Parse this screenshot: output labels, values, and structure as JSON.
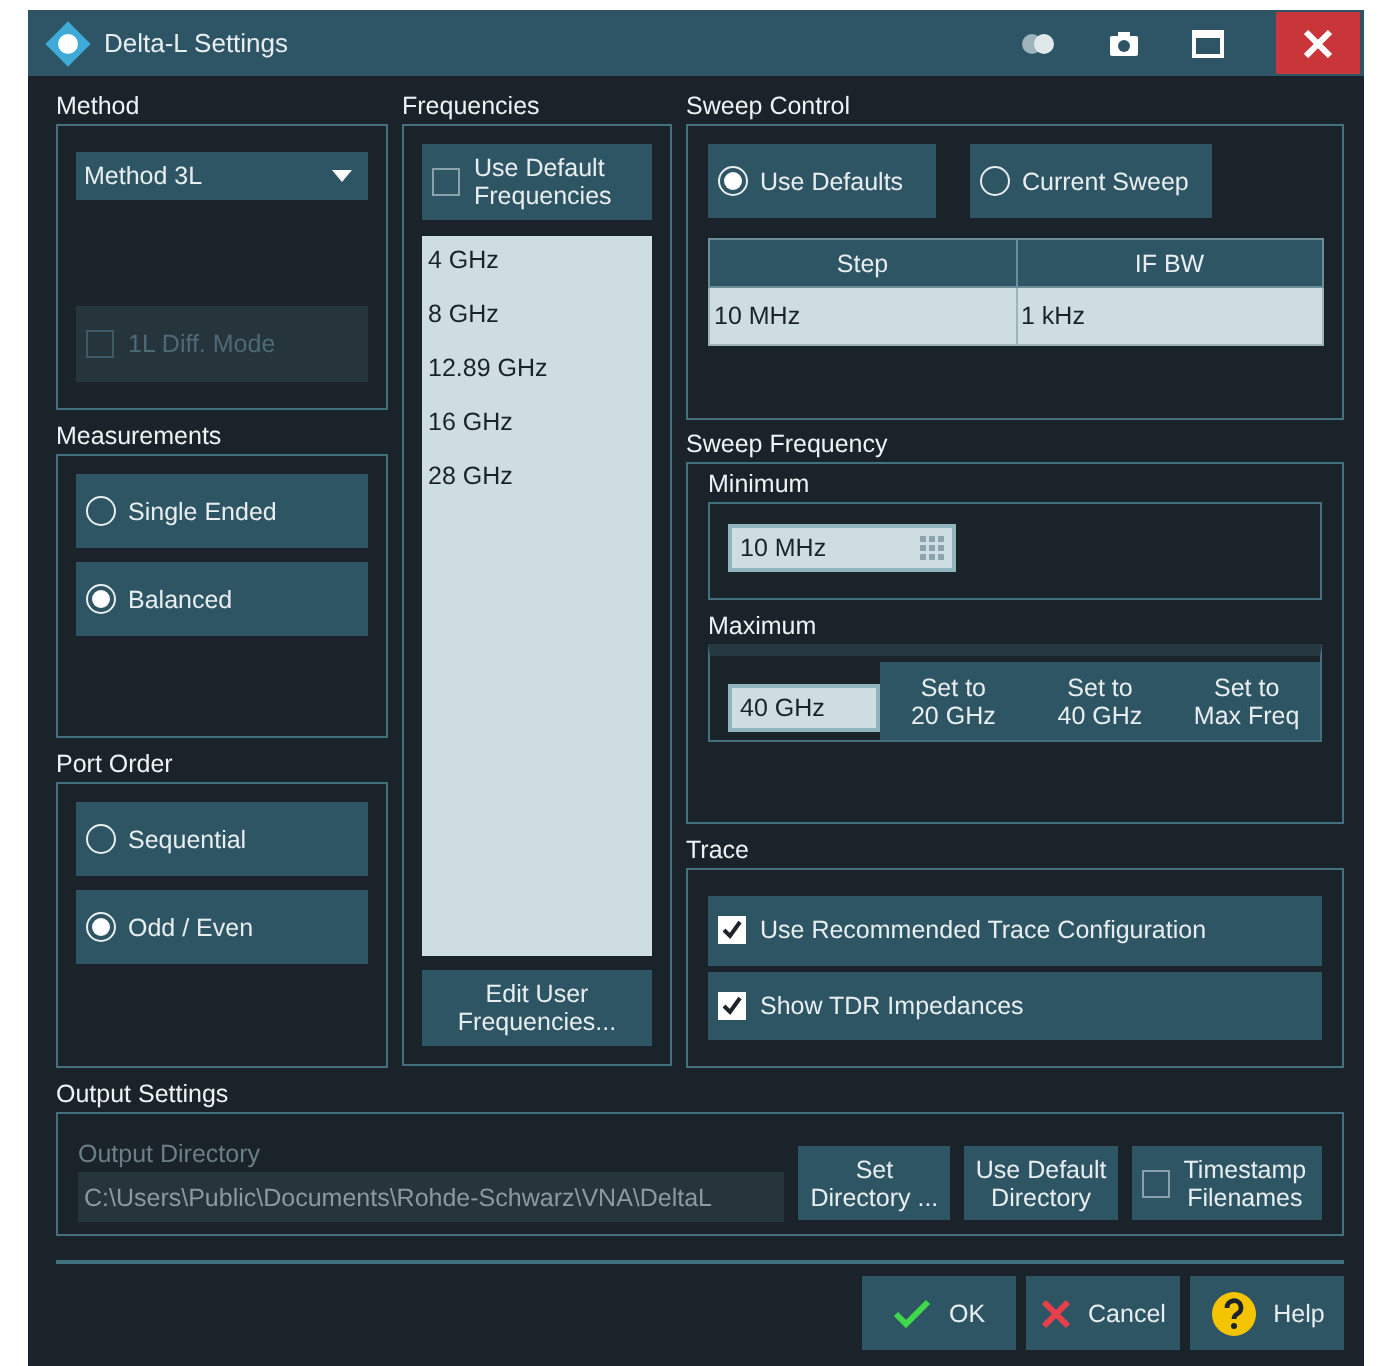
{
  "window": {
    "title": "Delta-L Settings"
  },
  "method": {
    "title": "Method",
    "dropdown": "Method 3L",
    "diff_mode": {
      "label": "1L Diff. Mode",
      "checked": false,
      "disabled": true
    }
  },
  "measurements": {
    "title": "Measurements",
    "options": [
      {
        "label": "Single Ended",
        "selected": false
      },
      {
        "label": "Balanced",
        "selected": true
      }
    ]
  },
  "port_order": {
    "title": "Port Order",
    "options": [
      {
        "label": "Sequential",
        "selected": false
      },
      {
        "label": "Odd / Even",
        "selected": true
      }
    ]
  },
  "frequencies": {
    "title": "Frequencies",
    "use_default": {
      "label": "Use Default\nFrequencies",
      "checked": false
    },
    "items": [
      "4 GHz",
      "8 GHz",
      "12.89 GHz",
      "16 GHz",
      "28 GHz"
    ],
    "edit_button": "Edit User\nFrequencies..."
  },
  "sweep_control": {
    "title": "Sweep Control",
    "options": [
      {
        "label": "Use Defaults",
        "selected": true
      },
      {
        "label": "Current Sweep",
        "selected": false
      }
    ],
    "table": {
      "columns": [
        "Step",
        "IF BW"
      ],
      "rows": [
        [
          "10 MHz",
          "1 kHz"
        ]
      ]
    }
  },
  "sweep_frequency": {
    "title": "Sweep Frequency",
    "minimum": {
      "label": "Minimum",
      "value": "10 MHz"
    },
    "maximum": {
      "label": "Maximum",
      "value": "40 GHz",
      "presets": [
        "Set to\n20 GHz",
        "Set to\n40 GHz",
        "Set to\nMax Freq"
      ]
    }
  },
  "trace": {
    "title": "Trace",
    "options": [
      {
        "label": "Use Recommended Trace Configuration",
        "checked": true
      },
      {
        "label": "Show TDR Impedances",
        "checked": true
      }
    ]
  },
  "output": {
    "title": "Output Settings",
    "directory_label": "Output Directory",
    "directory": "C:\\Users\\Public\\Documents\\Rohde-Schwarz\\VNA\\DeltaL",
    "buttons": [
      "Set\nDirectory ...",
      "Use Default\nDirectory"
    ],
    "timestamp": {
      "label": "Timestamp\nFilenames",
      "checked": false
    }
  },
  "buttons": [
    {
      "kind": "ok",
      "label": "OK"
    },
    {
      "kind": "cancel",
      "label": "Cancel"
    },
    {
      "kind": "help",
      "label": "Help"
    }
  ]
}
